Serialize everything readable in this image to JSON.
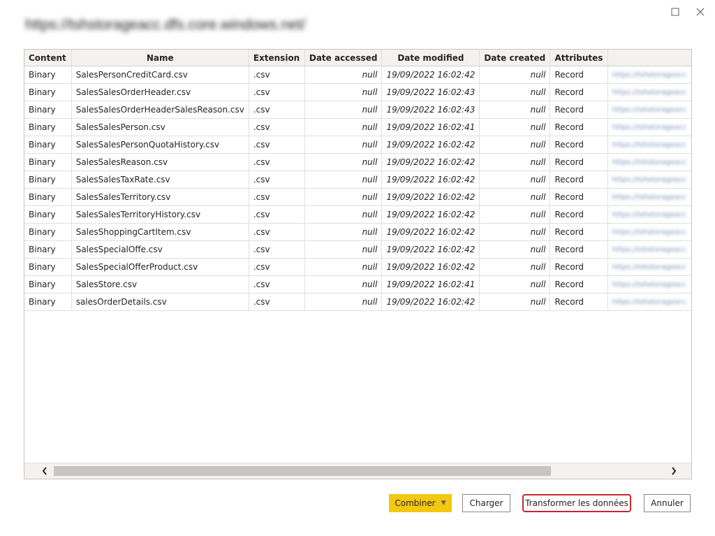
{
  "window": {
    "maximize_icon": "maximize-icon",
    "close_icon": "close-icon"
  },
  "dialog": {
    "title": "https://tshstorageacc.dfs.core.windows.net/"
  },
  "table": {
    "columns": [
      "Content",
      "Name",
      "Extension",
      "Date accessed",
      "Date modified",
      "Date created",
      "Attributes",
      ""
    ],
    "rows": [
      [
        "Binary",
        "SalesPersonCreditCard.csv",
        ".csv",
        "null",
        "19/09/2022 16:02:42",
        "null",
        "Record",
        "https://tshstorageacc"
      ],
      [
        "Binary",
        "SalesSalesOrderHeader.csv",
        ".csv",
        "null",
        "19/09/2022 16:02:43",
        "null",
        "Record",
        "https://tshstorageacc"
      ],
      [
        "Binary",
        "SalesSalesOrderHeaderSalesReason.csv",
        ".csv",
        "null",
        "19/09/2022 16:02:43",
        "null",
        "Record",
        "https://tshstorageacc"
      ],
      [
        "Binary",
        "SalesSalesPerson.csv",
        ".csv",
        "null",
        "19/09/2022 16:02:41",
        "null",
        "Record",
        "https://tshstorageacc"
      ],
      [
        "Binary",
        "SalesSalesPersonQuotaHistory.csv",
        ".csv",
        "null",
        "19/09/2022 16:02:42",
        "null",
        "Record",
        "https://tshstorageacc"
      ],
      [
        "Binary",
        "SalesSalesReason.csv",
        ".csv",
        "null",
        "19/09/2022 16:02:42",
        "null",
        "Record",
        "https://tshstorageacc"
      ],
      [
        "Binary",
        "SalesSalesTaxRate.csv",
        ".csv",
        "null",
        "19/09/2022 16:02:42",
        "null",
        "Record",
        "https://tshstorageacc"
      ],
      [
        "Binary",
        "SalesSalesTerritory.csv",
        ".csv",
        "null",
        "19/09/2022 16:02:42",
        "null",
        "Record",
        "https://tshstorageacc"
      ],
      [
        "Binary",
        "SalesSalesTerritoryHistory.csv",
        ".csv",
        "null",
        "19/09/2022 16:02:42",
        "null",
        "Record",
        "https://tshstorageacc"
      ],
      [
        "Binary",
        "SalesShoppingCartItem.csv",
        ".csv",
        "null",
        "19/09/2022 16:02:42",
        "null",
        "Record",
        "https://tshstorageacc"
      ],
      [
        "Binary",
        "SalesSpecialOffe.csv",
        ".csv",
        "null",
        "19/09/2022 16:02:42",
        "null",
        "Record",
        "https://tshstorageacc"
      ],
      [
        "Binary",
        "SalesSpecialOfferProduct.csv",
        ".csv",
        "null",
        "19/09/2022 16:02:42",
        "null",
        "Record",
        "https://tshstorageacc"
      ],
      [
        "Binary",
        "SalesStore.csv",
        ".csv",
        "null",
        "19/09/2022 16:02:41",
        "null",
        "Record",
        "https://tshstorageacc"
      ],
      [
        "Binary",
        "salesOrderDetails.csv",
        ".csv",
        "null",
        "19/09/2022 16:02:42",
        "null",
        "Record",
        "https://tshstorageacc"
      ]
    ]
  },
  "scrollbar": {
    "left_icon": "chevron-left-icon",
    "right_icon": "chevron-right-icon"
  },
  "buttons": {
    "combine": "Combiner",
    "load": "Charger",
    "transform": "Transformer les données",
    "cancel": "Annuler"
  },
  "colors": {
    "combine_accent": "#f2c811",
    "highlight_border": "#c4262e"
  }
}
